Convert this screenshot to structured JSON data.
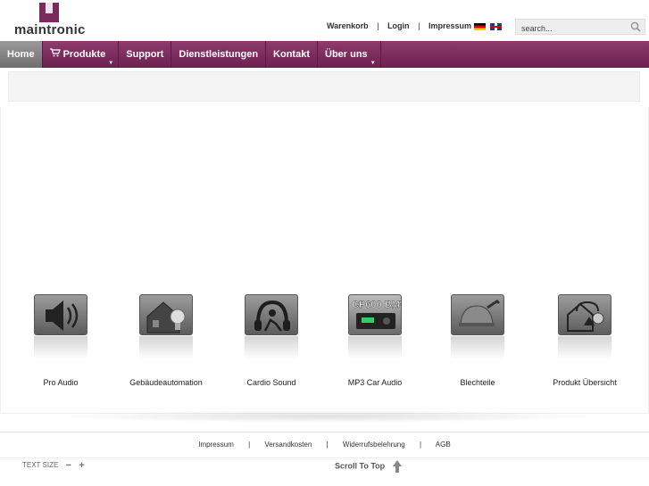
{
  "brand": {
    "name": "maintronic"
  },
  "toplinks": {
    "cart": "Warenkorb",
    "sep": "|",
    "login": "Login",
    "imprint": "Impressum"
  },
  "language_flags": [
    "de",
    "en"
  ],
  "search": {
    "placeholder": "search..."
  },
  "nav": {
    "items": [
      {
        "label": "Home",
        "active": true
      },
      {
        "label": "Produkte",
        "has_dropdown": true,
        "icon": "cart-icon"
      },
      {
        "label": "Support"
      },
      {
        "label": "Dienstleistungen"
      },
      {
        "label": "Kontakt"
      },
      {
        "label": "Über uns",
        "has_dropdown": true
      }
    ]
  },
  "categories": [
    {
      "label": "Pro Audio",
      "icon": "speaker-icon"
    },
    {
      "label": "Gebäudeautomation",
      "icon": "house-bulb-icon"
    },
    {
      "label": "Cardio Sound",
      "icon": "headphones-person-icon"
    },
    {
      "label": "MP3 Car Audio",
      "icon": "car-radio-icon",
      "tile_text": "CP600 BMW"
    },
    {
      "label": "Blechteile",
      "icon": "helmet-wrench-icon"
    },
    {
      "label": "Produkt Übersicht",
      "icon": "overview-icon"
    }
  ],
  "footer": {
    "links": [
      "Impressum",
      "Versandkosten",
      "Widerrufsbelehrung",
      "AGB"
    ],
    "sep": "|",
    "text_size_label": "TEXT SIZE",
    "decrease": "−",
    "increase": "+",
    "scroll_to_top": "Scroll To Top"
  },
  "colors": {
    "nav_accent": "#7a2a5b",
    "nav_active": "#888888"
  }
}
